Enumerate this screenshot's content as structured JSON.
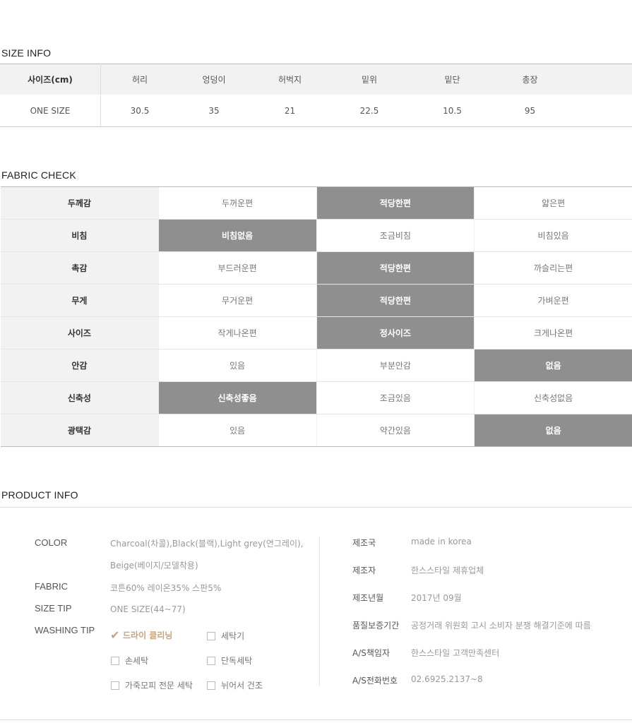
{
  "size_info": {
    "title": "SIZE INFO",
    "headers": [
      "사이즈(cm)",
      "허리",
      "엉덩이",
      "허벅지",
      "밑위",
      "밑단",
      "총장",
      ""
    ],
    "row": [
      "ONE SIZE",
      "30.5",
      "35",
      "21",
      "22.5",
      "10.5",
      "95",
      ""
    ]
  },
  "fabric_check": {
    "title": "FABRIC CHECK",
    "rows": [
      {
        "label": "두께감",
        "options": [
          "두꺼운편",
          "적당한편",
          "얇은편"
        ],
        "selected": 1
      },
      {
        "label": "비침",
        "options": [
          "비침없음",
          "조금비침",
          "비침있음"
        ],
        "selected": 0
      },
      {
        "label": "촉감",
        "options": [
          "부드러운편",
          "적당한편",
          "까슬리는편"
        ],
        "selected": 1
      },
      {
        "label": "무게",
        "options": [
          "무거운편",
          "적당한편",
          "가벼운편"
        ],
        "selected": 1
      },
      {
        "label": "사이즈",
        "options": [
          "작게나온편",
          "정사이즈",
          "크게나온편"
        ],
        "selected": 1
      },
      {
        "label": "안감",
        "options": [
          "있음",
          "부분안감",
          "없음"
        ],
        "selected": 2
      },
      {
        "label": "신축성",
        "options": [
          "신축성좋음",
          "조금있음",
          "신축성없음"
        ],
        "selected": 0
      },
      {
        "label": "광택감",
        "options": [
          "있음",
          "약간있음",
          "없음"
        ],
        "selected": 2
      }
    ]
  },
  "product_info": {
    "title": "PRODUCT INFO",
    "color_label": "COLOR",
    "color_value_1": "Charcoal(차콜),Black(블랙),Light grey(연그레이),",
    "color_value_2": "Beige(베이지/모델착용)",
    "fabric_label": "FABRIC",
    "fabric_value": "코튼60% 레이온35% 스판5%",
    "size_tip_label": "SIZE TIP",
    "size_tip_value": "ONE SIZE(44~77)",
    "washing_tip_label": "WASHING TIP",
    "washing": [
      {
        "label": "드라이 클리닝",
        "checked": true
      },
      {
        "label": "세탁기",
        "checked": false
      },
      {
        "label": "손세탁",
        "checked": false
      },
      {
        "label": "단독세탁",
        "checked": false
      },
      {
        "label": "가죽모피 전문 세탁",
        "checked": false
      },
      {
        "label": "뉘어서 건조",
        "checked": false
      }
    ],
    "right": [
      {
        "key": "제조국",
        "value": "made in korea"
      },
      {
        "key": "제조자",
        "value": "한스스타일 제휴업체"
      },
      {
        "key": "제조년월",
        "value": "2017년 09월"
      },
      {
        "key": "품질보증기간",
        "value": "공정거래 위원회 고시 소비자 분쟁 해결기준에 따름"
      },
      {
        "key": "A/S책임자",
        "value": "한스스타일 고객만족센터"
      },
      {
        "key": "A/S전화번호",
        "value": "02.6925.2137~8"
      }
    ]
  }
}
